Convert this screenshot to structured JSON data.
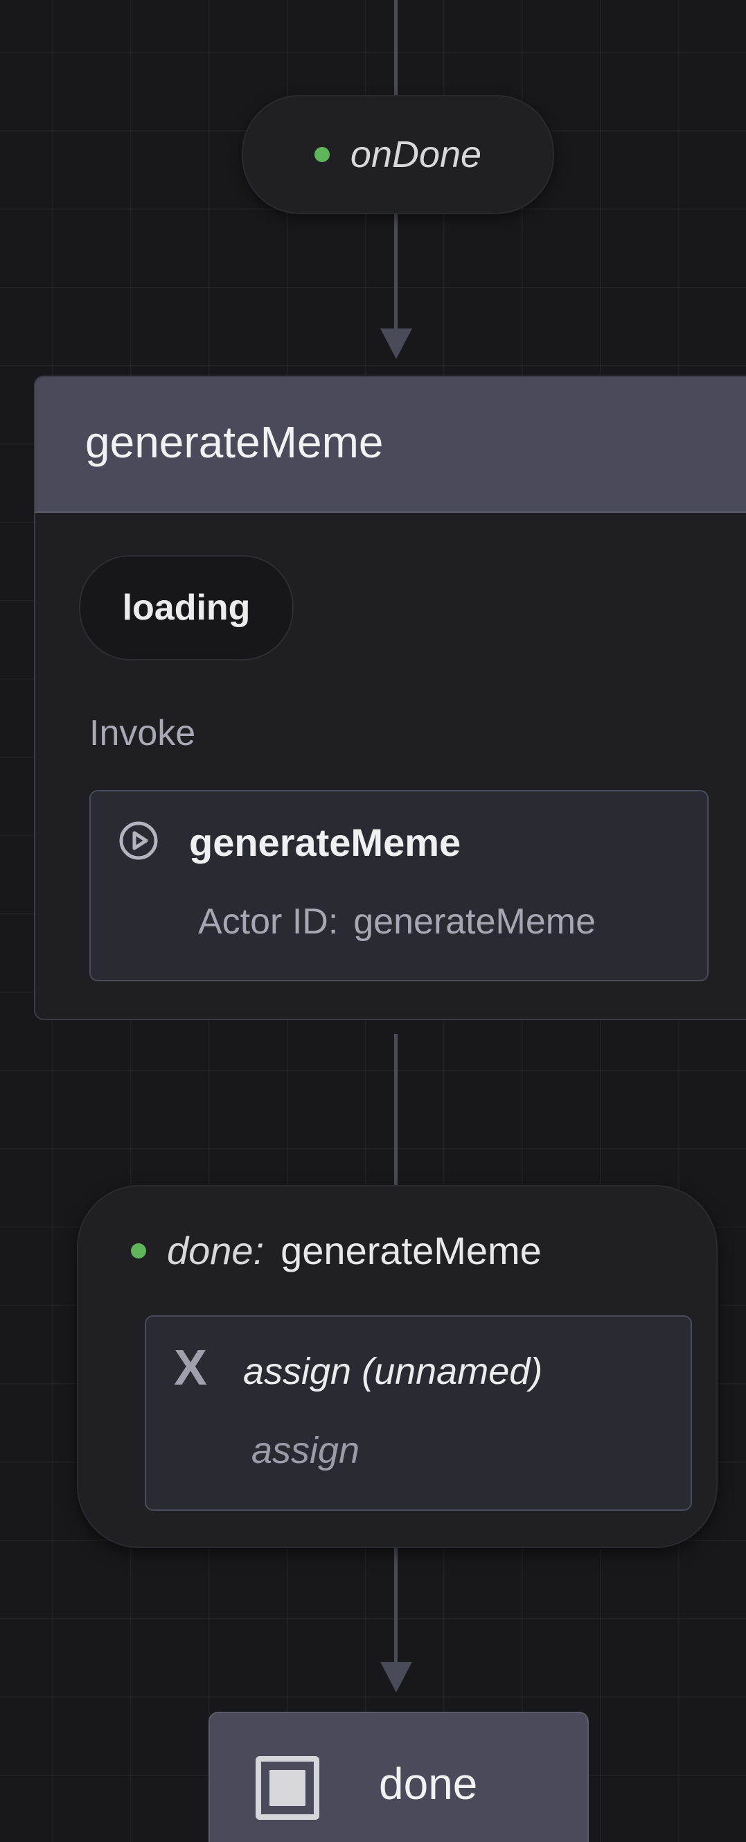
{
  "top_event": {
    "label": "onDone",
    "dot_color": "#5fb55a"
  },
  "state": {
    "title": "generateMeme",
    "tag": "loading",
    "invoke_section_label": "Invoke",
    "invoke": {
      "icon": "play-circle-icon",
      "name": "generateMeme",
      "actor_id_label": "Actor ID:",
      "actor_id_value": "generateMeme"
    }
  },
  "transition": {
    "event": "done:",
    "target": "generateMeme",
    "dot_color": "#5fb55a",
    "action": {
      "icon": "x-icon",
      "title": "assign (unnamed)",
      "type": "assign"
    }
  },
  "final_state": {
    "icon": "final-state-icon",
    "title": "done"
  },
  "colors": {
    "background": "#18181c",
    "edge": "#4a4b58",
    "header": "#4a4a5a",
    "card": "#2a2a33",
    "accent_green": "#5fb55a"
  }
}
